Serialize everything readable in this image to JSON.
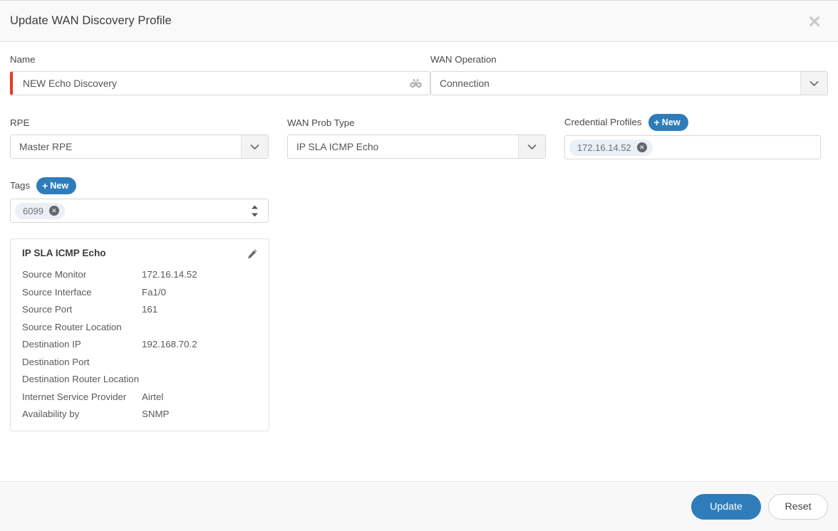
{
  "header": {
    "title": "Update WAN Discovery Profile",
    "close_icon": "close-icon"
  },
  "form": {
    "name": {
      "label": "Name",
      "value": "NEW Echo Discovery",
      "placeholder": "Name",
      "icon": "binoculars-icon",
      "required_accent": "#e8392b"
    },
    "wan_operation": {
      "label": "WAN Operation",
      "value": "Connection",
      "icon": "chevron-down-icon"
    },
    "rpe": {
      "label": "RPE",
      "value": "Master RPE",
      "icon": "chevron-down-icon"
    },
    "wan_prob_type": {
      "label": "WAN Prob Type",
      "value": "IP SLA ICMP Echo",
      "icon": "chevron-down-icon"
    },
    "credential_profiles": {
      "label": "Credential Profiles",
      "new_button": "New",
      "chips": [
        "172.16.14.52"
      ]
    },
    "tags": {
      "label": "Tags",
      "new_button": "New",
      "chips": [
        "6099"
      ],
      "stepper_icon": "updown-stepper-icon"
    }
  },
  "detail_card": {
    "title": "IP SLA ICMP Echo",
    "edit_icon": "pencil-icon",
    "rows": [
      {
        "label": "Source Monitor",
        "value": "172.16.14.52"
      },
      {
        "label": "Source Interface",
        "value": "Fa1/0"
      },
      {
        "label": "Source Port",
        "value": "161"
      },
      {
        "label": "Source Router Location",
        "value": ""
      },
      {
        "label": "Destination IP",
        "value": "192.168.70.2"
      },
      {
        "label": "Destination Port",
        "value": ""
      },
      {
        "label": "Destination Router Location",
        "value": ""
      },
      {
        "label": "Internet Service Provider",
        "value": "Airtel"
      },
      {
        "label": "Availability by",
        "value": "SNMP"
      }
    ]
  },
  "footer": {
    "update_label": "Update",
    "reset_label": "Reset"
  },
  "colors": {
    "accent_blue": "#2e7dba",
    "required_red": "#e8392b",
    "chip_bg": "#eceff3"
  }
}
